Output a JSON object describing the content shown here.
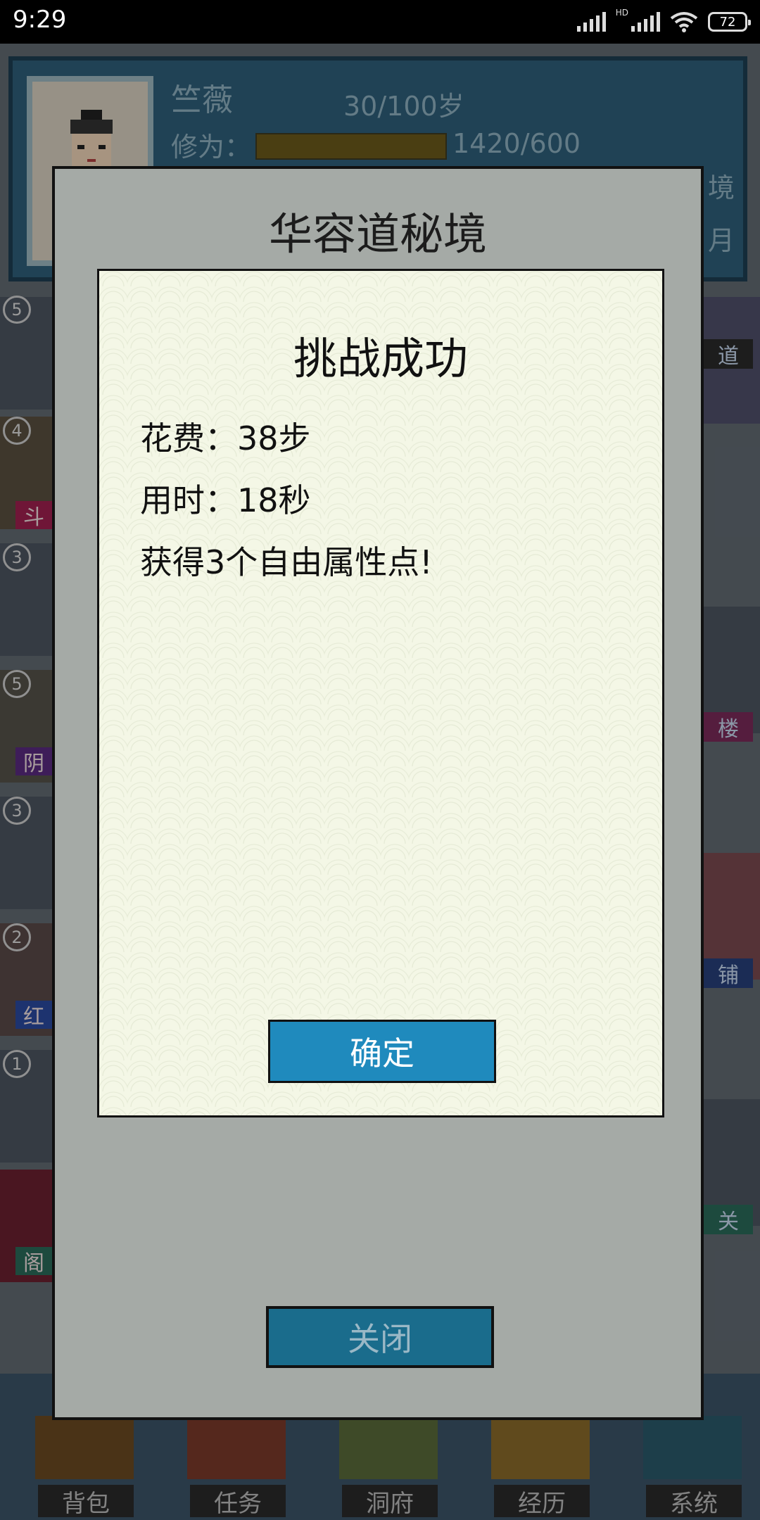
{
  "status_bar": {
    "time": "9:29",
    "network_label": "HD",
    "battery": "72"
  },
  "profile": {
    "name": "竺薇",
    "age": "30/100岁",
    "xiuwei_label": "修为：",
    "xiuwei_value": "1420/600",
    "right_partial_1": "境",
    "right_partial_2": "月"
  },
  "background_tiles": {
    "left_badges": [
      "5",
      "4",
      "3",
      "5",
      "3",
      "2",
      "1"
    ],
    "left_tags": [
      "斗",
      "阴",
      "红",
      "阁"
    ],
    "right_tags": [
      "楼",
      "铺",
      "关"
    ],
    "right_partial_top": "道"
  },
  "bottom_nav": {
    "items": [
      "背包",
      "任务",
      "洞府",
      "经历",
      "系统"
    ]
  },
  "outer_dialog": {
    "title": "华容道秘境",
    "close_label": "关闭"
  },
  "inner_dialog": {
    "title": "挑战成功",
    "cost_line": "花费：38步",
    "time_line": "用时：18秒",
    "reward_line": "获得3个自由属性点!",
    "confirm_label": "确定"
  },
  "colors": {
    "confirm_button": "#1f8abd",
    "close_button": "#1a6c8c",
    "inner_dialog_bg": "#f4f7e6",
    "outer_dialog_bg": "#a5aaa6"
  }
}
